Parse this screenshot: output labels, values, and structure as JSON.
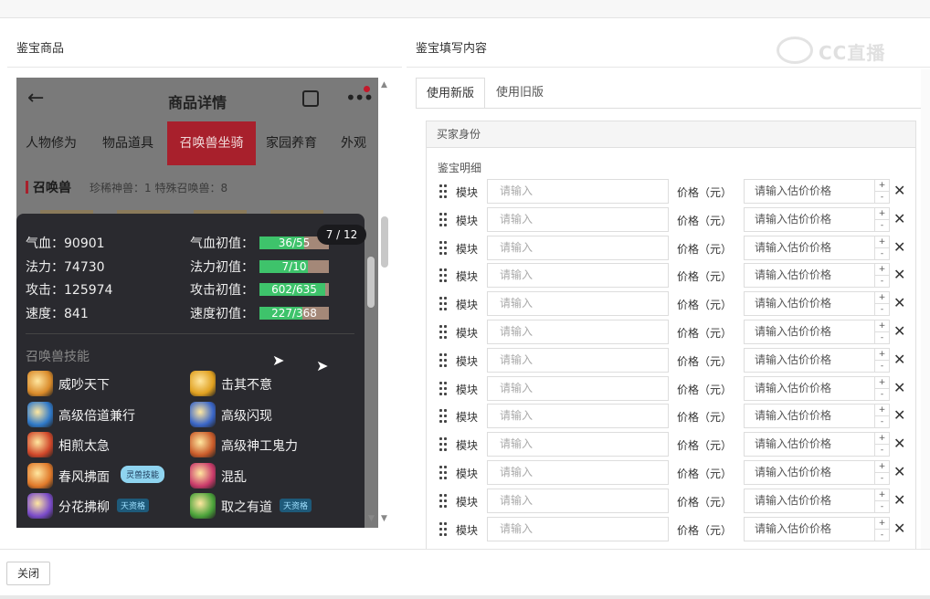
{
  "left_panel": {
    "title": "鉴宝商品"
  },
  "right_panel": {
    "title": "鉴宝填写内容"
  },
  "watermark": {
    "text": "CC直播"
  },
  "phone": {
    "title": "商品详情",
    "tabs": [
      "人物修为",
      "物品道具",
      "召唤兽坐骑",
      "家园养育",
      "外观"
    ],
    "active_tab": "召唤兽坐骑",
    "section": "召唤兽",
    "section_info": "珍稀神兽：1   特殊召唤兽：8",
    "counter": "7 / 12",
    "stats_left": [
      {
        "label": "气血：90901"
      },
      {
        "label": "法力：74730"
      },
      {
        "label": "攻击：125974"
      },
      {
        "label": "速度：841"
      }
    ],
    "stats_right": [
      {
        "label": "气血初值：",
        "value": "36/55",
        "fill": 0.65
      },
      {
        "label": "法力初值：",
        "value": "7/10",
        "fill": 0.7
      },
      {
        "label": "攻击初值：",
        "value": "602/635",
        "fill": 0.95
      },
      {
        "label": "速度初值：",
        "value": "227/368",
        "fill": 0.62
      }
    ],
    "skills_heading": "召唤兽技能",
    "skills": [
      {
        "name": "威吵天下",
        "color": "#d98a2a"
      },
      {
        "name": "击其不意",
        "color": "#e0a020"
      },
      {
        "name": "高级倍道兼行",
        "color": "#2f79c9"
      },
      {
        "name": "高级闪现",
        "color": "#3a66c8"
      },
      {
        "name": "相煎太急",
        "color": "#d0472a"
      },
      {
        "name": "高级神工鬼力",
        "color": "#c95b2a"
      },
      {
        "name": "春风拂面",
        "color": "#e0792a",
        "badge": "灵兽技能"
      },
      {
        "name": "混乱",
        "color": "#c93a6a"
      },
      {
        "name": "分花拂柳",
        "color": "#7a4bc9",
        "badge": "天资格"
      },
      {
        "name": "取之有道",
        "color": "#4aa23a",
        "badge": "天资格"
      }
    ]
  },
  "tabs": {
    "new": "使用新版",
    "old": "使用旧版"
  },
  "buyer": {
    "header": "买家身份",
    "sub": "鉴宝明细",
    "row_label": "模块",
    "input_placeholder": "请输入",
    "price_label": "价格（元）",
    "price_placeholder": "请输入估价价格",
    "row_count": 13
  },
  "footer": {
    "close": "关闭"
  }
}
